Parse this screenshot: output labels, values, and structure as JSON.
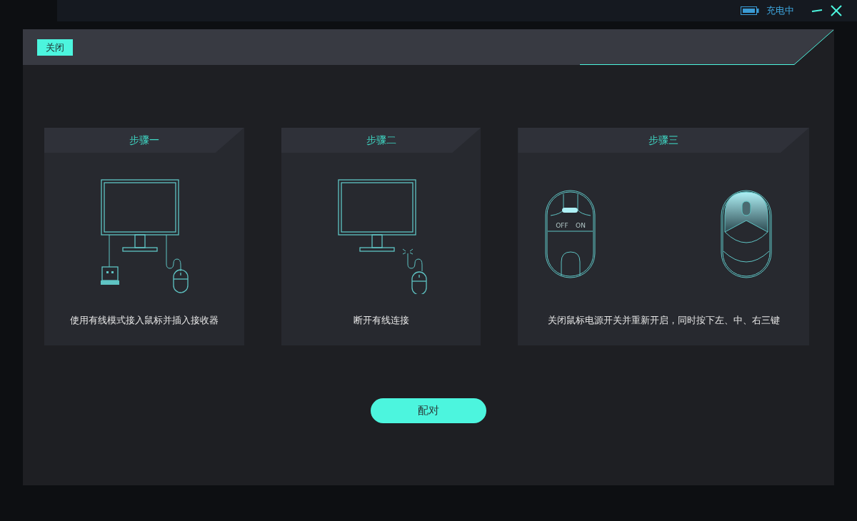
{
  "top_bar": {
    "battery_status": "充电中"
  },
  "dialog": {
    "close_button": "关闭",
    "steps": [
      {
        "title": "步骤一",
        "kind": "wired",
        "caption": "使用有线模式接入鼠标并插入接收器"
      },
      {
        "title": "步骤二",
        "kind": "unplug",
        "caption": "断开有线连接"
      },
      {
        "title": "步骤三",
        "kind": "power_cycle",
        "caption": "关闭鼠标电源开关并重新开启，同时按下左、中、右三键",
        "switch_labels": [
          "OFF",
          "ON"
        ]
      }
    ],
    "pair_button": "配对"
  }
}
